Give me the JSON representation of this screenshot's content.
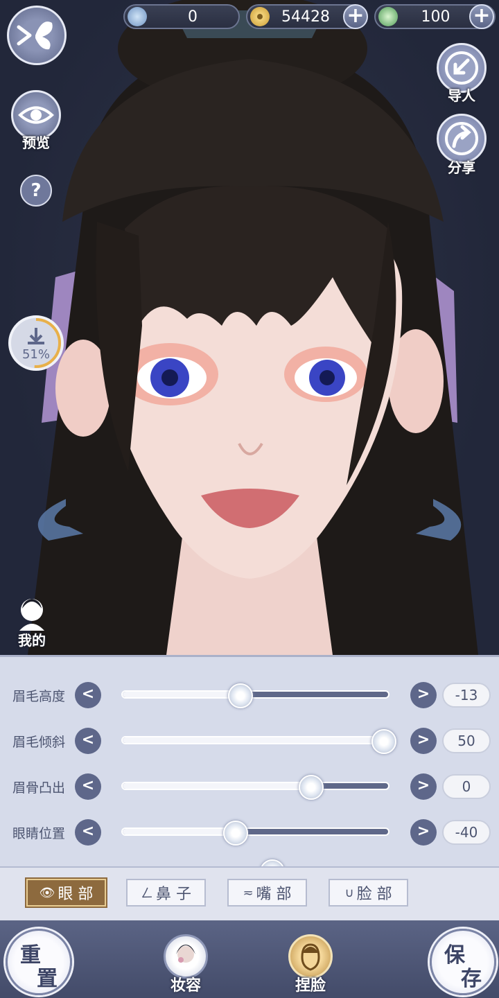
{
  "currencies": [
    {
      "icon": "jade-icon",
      "value": "0"
    },
    {
      "icon": "coin-icon",
      "value": "54428"
    },
    {
      "icon": "swirl-token-icon",
      "value": "100"
    }
  ],
  "left_controls": {
    "preview_label": "预览",
    "help_label": "?",
    "download_progress": "51%",
    "download_fraction": 0.51,
    "mine_label": "我的"
  },
  "right_controls": {
    "import_label": "导人",
    "share_label": "分享"
  },
  "sliders": [
    {
      "label": "眉毛高度",
      "value": "-13",
      "position": 0.445
    },
    {
      "label": "眉毛倾斜",
      "value": "50",
      "position": 0.985
    },
    {
      "label": "眉骨凸出",
      "value": "0",
      "position": 0.71
    },
    {
      "label": "眼睛位置",
      "value": "-40",
      "position": 0.425
    }
  ],
  "tabs": [
    {
      "label": "眼 部",
      "icon": "eye-icon",
      "active": true
    },
    {
      "label": "鼻 子",
      "icon": "nose-icon",
      "active": false
    },
    {
      "label": "嘴 部",
      "icon": "mouth-icon",
      "active": false
    },
    {
      "label": "脸 部",
      "icon": "face-icon",
      "active": false
    }
  ],
  "bottom_nav": {
    "reset": [
      "重",
      "置"
    ],
    "makeup_label": "妆容",
    "face_label": "捏脸",
    "save": [
      "保",
      "存"
    ]
  },
  "colors": {
    "panel": "#d6dbea",
    "accent_active_tab": "#8d6a3e",
    "slider_track": "#5f6889",
    "nav_bar": "#4f5777"
  }
}
